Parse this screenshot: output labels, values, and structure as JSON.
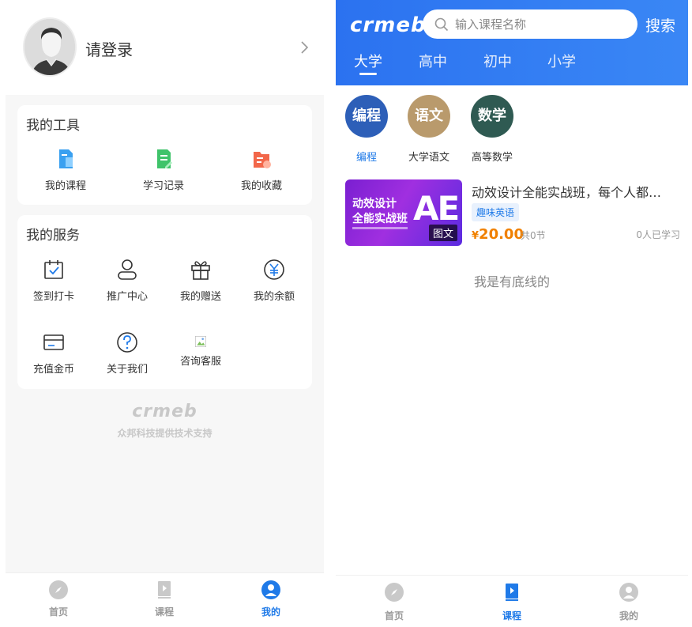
{
  "left": {
    "profile": {
      "login_text": "请登录"
    },
    "tools": {
      "title": "我的工具",
      "items": [
        {
          "label": "我的课程",
          "icon": "course-doc-icon",
          "color": "#3aa0f0"
        },
        {
          "label": "学习记录",
          "icon": "study-record-icon",
          "color": "#3fc36a"
        },
        {
          "label": "我的收藏",
          "icon": "favorite-folder-icon",
          "color": "#f2674a"
        }
      ]
    },
    "services": {
      "title": "我的服务",
      "items": [
        {
          "label": "签到打卡",
          "icon": "checkin-calendar-icon"
        },
        {
          "label": "推广中心",
          "icon": "user-icon"
        },
        {
          "label": "我的赠送",
          "icon": "gift-icon"
        },
        {
          "label": "我的余额",
          "icon": "yen-coin-icon"
        },
        {
          "label": "充值金币",
          "icon": "wallet-card-icon"
        },
        {
          "label": "关于我们",
          "icon": "help-question-icon"
        },
        {
          "label": "咨询客服",
          "icon": "broken-image-icon"
        }
      ]
    },
    "watermark": {
      "logo": "crmeb",
      "text": "众邦科技提供技术支持"
    },
    "tabbar": [
      {
        "label": "首页",
        "icon": "compass-icon",
        "active": false
      },
      {
        "label": "课程",
        "icon": "play-book-icon",
        "active": false
      },
      {
        "label": "我的",
        "icon": "person-icon",
        "active": true
      }
    ]
  },
  "right": {
    "header": {
      "brand": "crmeb",
      "search_placeholder": "输入课程名称",
      "search_button": "搜索",
      "tabs": [
        {
          "label": "大学",
          "active": true
        },
        {
          "label": "高中",
          "active": false
        },
        {
          "label": "初中",
          "active": false
        },
        {
          "label": "小学",
          "active": false
        }
      ]
    },
    "subjects": [
      {
        "circle_text": "编程",
        "label": "编程",
        "color": "#2d5fb8",
        "active": true
      },
      {
        "circle_text": "语文",
        "label": "大学语文",
        "color": "#b99a6c",
        "active": false
      },
      {
        "circle_text": "数学",
        "label": "高等数学",
        "color": "#2f5a52",
        "active": false
      }
    ],
    "course": {
      "cover_line1": "动效设计",
      "cover_line2": "全能实战班",
      "cover_ae": "AE",
      "cover_badge": "图文",
      "title": "动效设计全能实战班，每个人都…",
      "tag": "趣味英语",
      "price_symbol": "¥",
      "price": "20.00",
      "lessons": "共0节",
      "learners": "0人已学习"
    },
    "bottom_line": "我是有底线的",
    "tabbar": [
      {
        "label": "首页",
        "icon": "compass-icon",
        "active": false
      },
      {
        "label": "课程",
        "icon": "play-book-icon",
        "active": true
      },
      {
        "label": "我的",
        "icon": "person-icon",
        "active": false
      }
    ]
  }
}
